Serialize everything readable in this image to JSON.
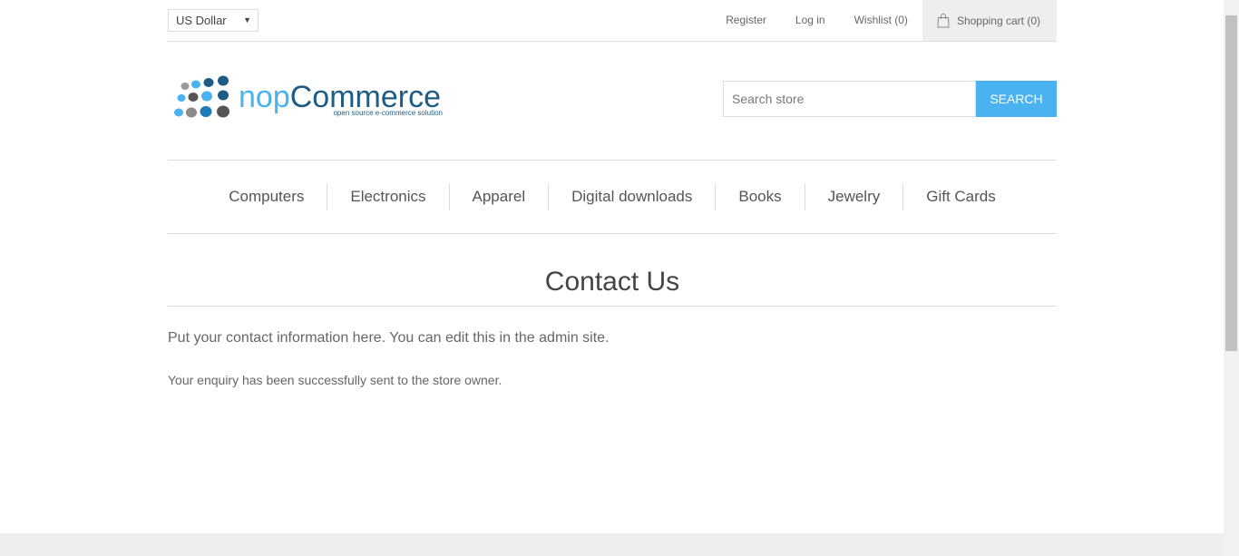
{
  "header": {
    "currency": "US Dollar",
    "links": {
      "register": "Register",
      "login": "Log in",
      "wishlist": "Wishlist (0)",
      "cart": "Shopping cart (0)"
    }
  },
  "logo": {
    "name": "nopCommerce",
    "tagline": "open source e-commerce solution"
  },
  "search": {
    "placeholder": "Search store",
    "button": "SEARCH"
  },
  "menu": {
    "items": [
      "Computers",
      "Electronics",
      "Apparel",
      "Digital downloads",
      "Books",
      "Jewelry",
      "Gift Cards"
    ]
  },
  "page": {
    "title": "Contact Us",
    "topic": "Put your contact information here. You can edit this in the admin site.",
    "result": "Your enquiry has been successfully sent to the store owner."
  },
  "colors": {
    "accent": "#4ab2f1",
    "logo_blue": "#1e5c85",
    "logo_light_blue": "#4ab2f1"
  }
}
